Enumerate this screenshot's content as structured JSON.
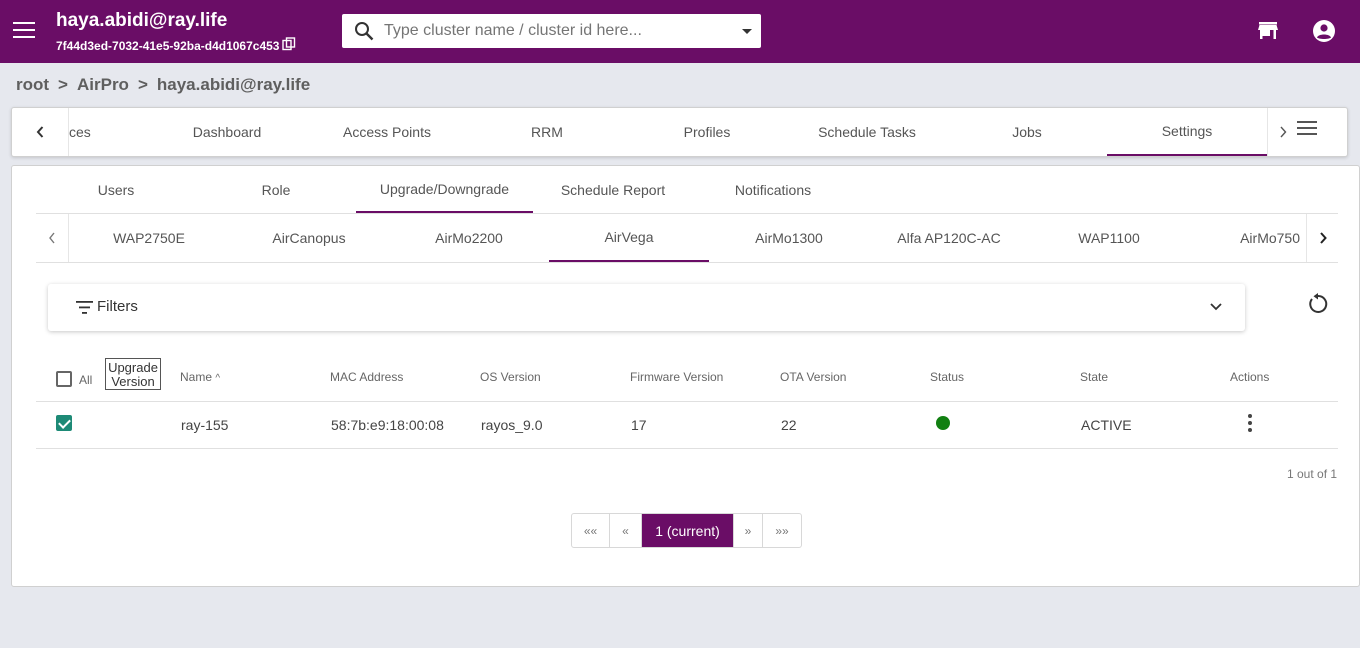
{
  "header": {
    "user_email": "haya.abidi@ray.life",
    "cluster_id": "7f44d3ed-7032-41e5-92ba-d4d1067c453",
    "search_placeholder": "Type cluster name / cluster id here...",
    "search_value": ""
  },
  "breadcrumb": {
    "root": "root",
    "sep1": ">",
    "org": "AirPro",
    "sep2": ">",
    "user": "haya.abidi@ray.life"
  },
  "main_tabs": {
    "items": [
      "ces",
      "Dashboard",
      "Access Points",
      "RRM",
      "Profiles",
      "Schedule Tasks",
      "Jobs",
      "Settings"
    ],
    "active": "Settings"
  },
  "settings_tabs": {
    "items": [
      "Users",
      "Role",
      "Upgrade/Downgrade",
      "Schedule Report",
      "Notifications"
    ],
    "active": "Upgrade/Downgrade"
  },
  "model_tabs": {
    "items": [
      "WAP2750E",
      "AirCanopus",
      "AirMo2200",
      "AirVega",
      "AirMo1300",
      "Alfa AP120C-AC",
      "WAP1100",
      "AirMo750"
    ],
    "active": "AirVega"
  },
  "filters": {
    "label": "Filters"
  },
  "table": {
    "all_label": "All",
    "upgrade_button": "Upgrade Version",
    "columns": [
      "Name",
      "MAC Address",
      "OS Version",
      "Firmware Version",
      "OTA Version",
      "Status",
      "State",
      "Actions"
    ],
    "sort_indicator": "^",
    "rows": [
      {
        "checked": true,
        "name": "ray-155",
        "mac": "58:7b:e9:18:00:08",
        "os": "rayos_9.0",
        "firmware": "17",
        "ota": "22",
        "status_color": "#118011",
        "state": "ACTIVE"
      }
    ],
    "count_text": "1 out of 1"
  },
  "pagination": {
    "first": "««",
    "prev": "«",
    "current": "1 (current)",
    "next": "»",
    "last": "»»"
  },
  "colors": {
    "brand": "#6a0d66",
    "checkbox": "#1d8a76",
    "status_active": "#118011"
  }
}
